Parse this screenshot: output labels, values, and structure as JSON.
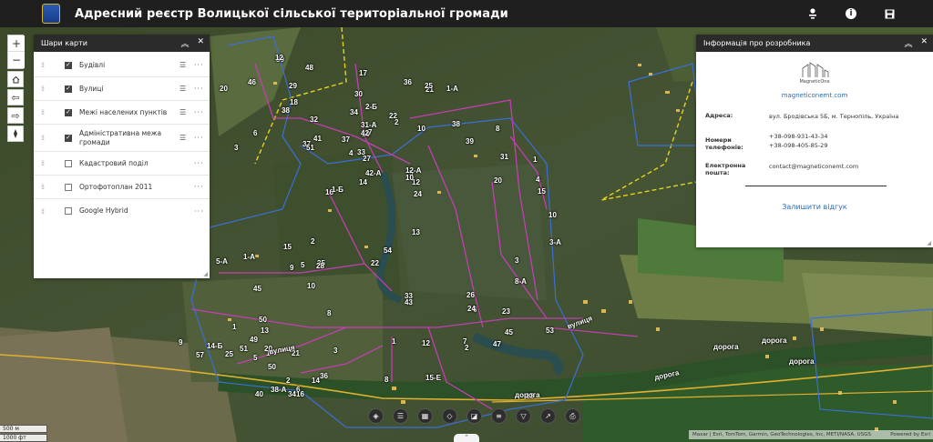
{
  "header": {
    "title": "Адресний реєстр Волицької сільської територіальної громади"
  },
  "layers_panel": {
    "title": "Шари карти",
    "layers": [
      {
        "label": "Будівлі",
        "checked": true
      },
      {
        "label": "Вулиці",
        "checked": true
      },
      {
        "label": "Межі населених пунктів",
        "checked": true
      },
      {
        "label": "Адміністративна межа громади",
        "checked": true
      },
      {
        "label": "Кадастровий поділ",
        "checked": false
      },
      {
        "label": "Ортофотоплан 2011",
        "checked": false
      },
      {
        "label": "Google Hybrid",
        "checked": false
      }
    ]
  },
  "info_panel": {
    "title": "Інформація про розробника",
    "logo_text": "MagneticOne",
    "website": "magneticonemt.com",
    "address_label": "Адреса:",
    "address_value": "вул. Бродівська 5Б, м. Тернопіль, Україна",
    "phones_label": "Номери телефонів:",
    "phone1": "+38-098-931-43-34",
    "phone2": "+38-098-405-85-29",
    "email_label": "Електронна пошта:",
    "email_value": "contact@magneticonemt.com",
    "feedback": "Залишити відгук"
  },
  "map": {
    "road_labels": [
      "дорога",
      "дорога",
      "дорога",
      "дорога",
      "дорога"
    ],
    "street_labels": [
      "вулиця",
      "вулиця"
    ],
    "house_numbers": [
      "38",
      "30",
      "39",
      "33",
      "35",
      "25",
      "23",
      "21",
      "19",
      "18",
      "17",
      "15",
      "13",
      "54",
      "49",
      "45",
      "40",
      "37",
      "29",
      "33",
      "38",
      "43",
      "45",
      "50",
      "47",
      "36",
      "41",
      "39",
      "34",
      "31",
      "10",
      "9",
      "5",
      "2",
      "1",
      "7",
      "6",
      "5",
      "4",
      "3",
      "2",
      "1",
      "12",
      "14",
      "16",
      "20",
      "22",
      "24",
      "26",
      "28",
      "57",
      "53",
      "51",
      "42-А",
      "37",
      "27",
      "21",
      "12-А",
      "10",
      "8",
      "6",
      "50",
      "51",
      "46",
      "36",
      "25",
      "20",
      "15",
      "13",
      "8",
      "2",
      "1-Б",
      "32",
      "2-Б",
      "12",
      "10",
      "1-А",
      "9",
      "7",
      "6",
      "4",
      "3",
      "2",
      "1",
      "24",
      "22",
      "20",
      "18",
      "16",
      "14",
      "12",
      "10",
      "8",
      "8-А",
      "5",
      "3",
      "1",
      "34",
      "42",
      "48",
      "31-А",
      "1-А",
      "3-А",
      "5-А",
      "14-Б",
      "15-Е",
      "38-А"
    ]
  },
  "scale": {
    "metric": "500 м",
    "imperial": "1000 фт"
  },
  "attribution": {
    "text": "Maxar | Esri, TomTom, Garmin, GeoTechnologies, Inc, METI/NASA, USGS",
    "powered": "Powered by Esri"
  },
  "colors": {
    "header_bg": "#1f1f1f",
    "panel_head_bg": "#2b2b2b",
    "street_line": "#c23fb2",
    "admin_boundary": "#e6d21e",
    "settlement_boundary": "#3a6fd6",
    "road": "#e0b030",
    "link": "#2b6bb5"
  }
}
